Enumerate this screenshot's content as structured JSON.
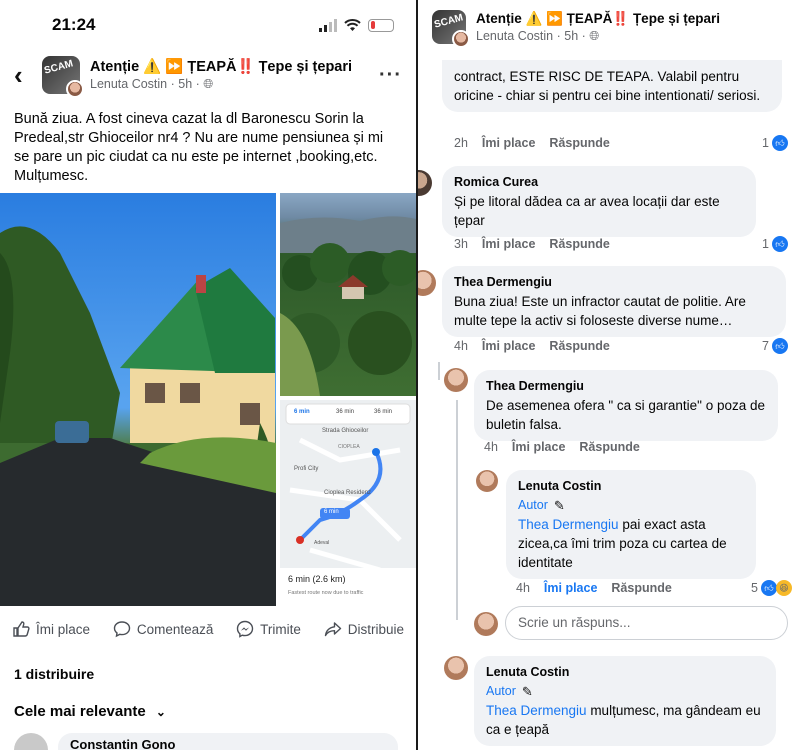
{
  "status_bar": {
    "time": "21:24"
  },
  "group": {
    "name": "Atenție ⚠️ ⏩ ȚEAPĂ‼️ Țepe și țepari",
    "logo_text": "SCAM"
  },
  "post": {
    "author": "Lenuta Costin",
    "time": "5h",
    "privacy_icon": "globe-icon",
    "text": "Bună ziua. A fost cineva cazat la dl Baronescu Sorin la Predeal,str Ghioceilor nr4 ? Nu are nume pensiunea și mi se pare un pic ciudat ca nu este pe internet ,booking,etc. Mulțumesc."
  },
  "map": {
    "modes": [
      "6 min",
      "36 min",
      "36 min"
    ],
    "labels": [
      "Strada Ghioceilor",
      "CIOPLEA",
      "Profi City",
      "Cioplea Residenz",
      "6 min",
      "Adeval"
    ],
    "summary": "6 min (2.6 km)",
    "note": "Fastest route now due to traffic"
  },
  "actions": {
    "like": "Îmi place",
    "comment": "Comentează",
    "send": "Trimite",
    "share": "Distribuie"
  },
  "shares": "1 distribuire",
  "sort": "Cele mai relevante",
  "partial_commenter": "Constantin Gono",
  "right": {
    "author": "Lenuta Costin",
    "time": "5h",
    "comments": [
      {
        "text": "contract, ESTE RISC DE TEAPA. Valabil pentru oricine - chiar si pentru cei bine intentionati/ seriosi.",
        "time": "2h",
        "like": "Îmi place",
        "reply": "Răspunde",
        "reactions": "1"
      },
      {
        "name": "Romica Curea",
        "text": "Și pe litoral dădea ca ar avea locații dar este țepar",
        "time": "3h",
        "like": "Îmi place",
        "reply": "Răspunde",
        "reactions": "1"
      },
      {
        "name": "Thea Dermengiu",
        "text": "Buna ziua! Este un infractor cautat de politie. Are multe tepe la activ si foloseste diverse nume…",
        "time": "4h",
        "like": "Îmi place",
        "reply": "Răspunde",
        "reactions": "7"
      },
      {
        "name": "Thea Dermengiu",
        "text": "De asemenea ofera \" ca si garantie\" o poza de buletin falsa.",
        "time": "4h",
        "like": "Îmi place",
        "reply": "Răspunde"
      },
      {
        "name": "Lenuta Costin",
        "badge": "Autor",
        "mention": "Thea Dermengiu",
        "text": " pai exact asta zicea,ca îmi trim poza cu cartea de identitate",
        "time": "4h",
        "like": "Îmi place",
        "reply": "Răspunde",
        "reactions": "5"
      },
      {
        "name": "Lenuta Costin",
        "badge": "Autor",
        "mention": "Thea Dermengiu",
        "text": " mulțumesc, ma gândeam eu ca e țeapă"
      }
    ],
    "reply_placeholder": "Scrie un răspuns..."
  },
  "colors": {
    "accent": "#1877f2",
    "bubble": "#f0f2f5",
    "muted": "#65676b"
  }
}
